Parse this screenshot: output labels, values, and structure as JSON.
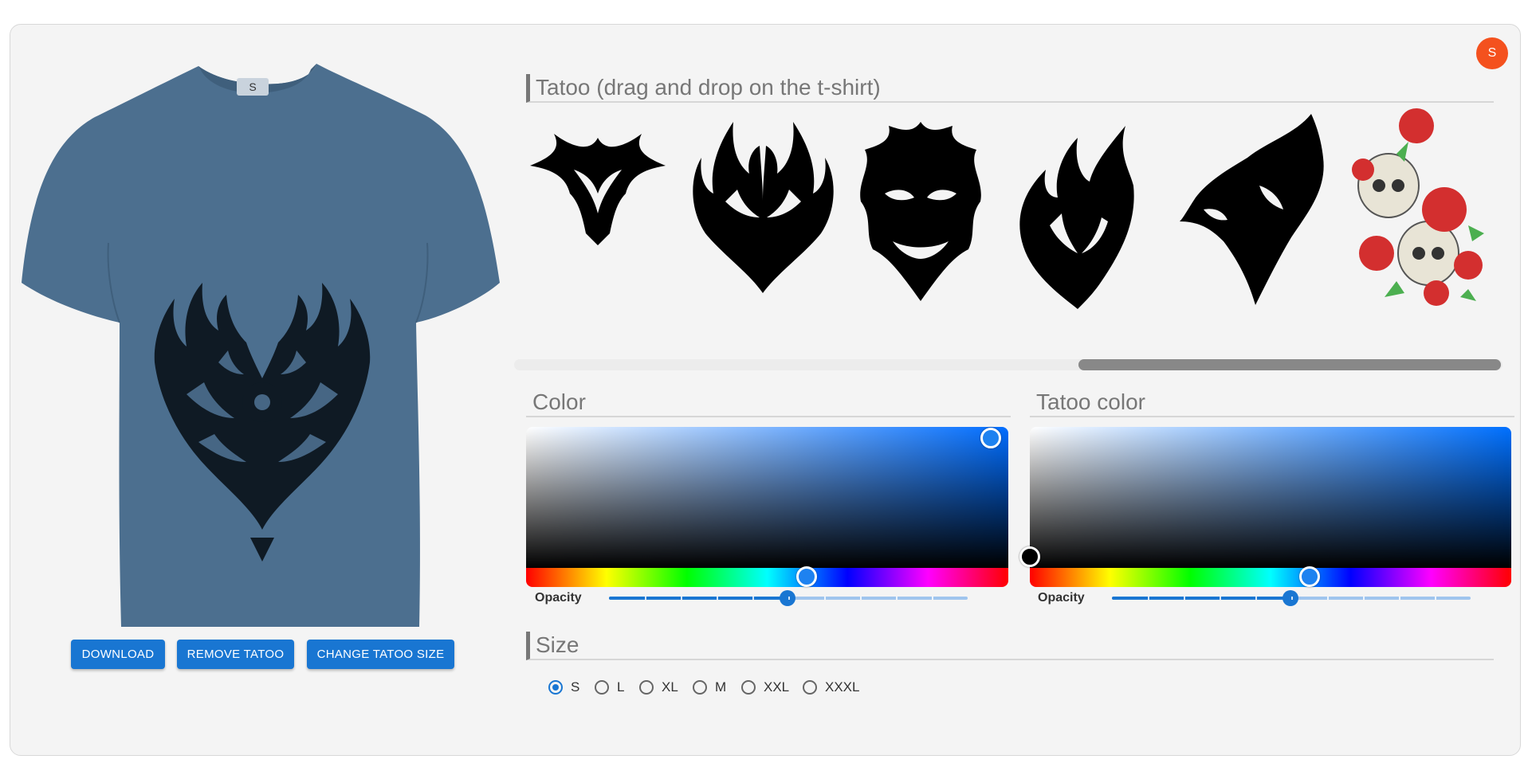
{
  "user": {
    "avatar_initial": "S"
  },
  "shirt": {
    "size_tag": "S",
    "shirt_color": "#4c6f8f",
    "tattoo_color": "#0f1a24",
    "selected_tattoo": "phoenix"
  },
  "actions": {
    "download": "DOWNLOAD",
    "remove": "REMOVE TATOO",
    "change_size": "CHANGE TATOO SIZE"
  },
  "tattoo_section": {
    "title": "Tatoo (drag and drop on the t-shirt)",
    "items": [
      {
        "icon": "dragon-tattoo-icon"
      },
      {
        "icon": "phoenix-tattoo-icon"
      },
      {
        "icon": "tribal-mask-tattoo-icon"
      },
      {
        "icon": "tribal-flame-tattoo-icon"
      },
      {
        "icon": "wolf-tattoo-icon"
      },
      {
        "icon": "skull-roses-tattoo-icon"
      }
    ]
  },
  "color_picker": {
    "title": "Color",
    "hue_color": "#006dff",
    "opacity_label": "Opacity",
    "opacity": 0.5
  },
  "tattoo_color_picker": {
    "title": "Tatoo color",
    "hue_color": "#0070ff",
    "opacity_label": "Opacity",
    "opacity": 0.5
  },
  "size_section": {
    "title": "Size",
    "options": [
      "S",
      "L",
      "XL",
      "M",
      "XXL",
      "XXXL"
    ],
    "selected": "S"
  }
}
